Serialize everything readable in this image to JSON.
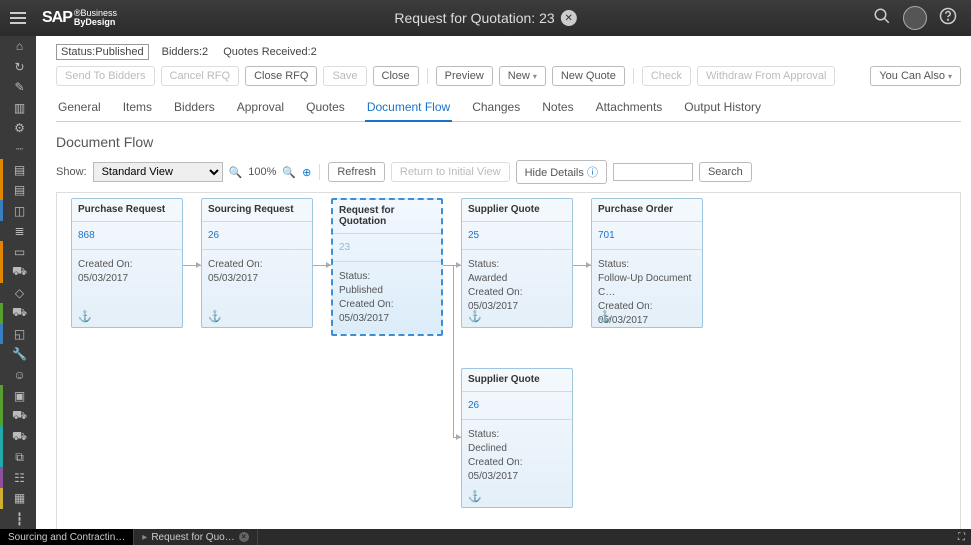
{
  "header": {
    "title": "Request for Quotation: 23"
  },
  "status_line": {
    "status_label": "Status:",
    "status_value": "Published",
    "bidders_label": "Bidders:",
    "bidders_value": "2",
    "quotes_label": "Quotes Received:",
    "quotes_value": "2"
  },
  "toolbar": {
    "send_to_bidders": "Send To Bidders",
    "cancel_rfq": "Cancel RFQ",
    "close_rfq": "Close RFQ",
    "save": "Save",
    "close": "Close",
    "preview": "Preview",
    "new": "New",
    "new_quote": "New Quote",
    "check": "Check",
    "withdraw": "Withdraw From Approval",
    "you_can_also": "You Can Also"
  },
  "tabs": [
    "General",
    "Items",
    "Bidders",
    "Approval",
    "Quotes",
    "Document Flow",
    "Changes",
    "Notes",
    "Attachments",
    "Output History"
  ],
  "active_tab": "Document Flow",
  "section_title": "Document Flow",
  "flow_tb": {
    "show_label": "Show:",
    "view": "Standard View",
    "zoom": "100%",
    "refresh": "Refresh",
    "return_initial": "Return to Initial View",
    "hide_details": "Hide Details",
    "search": "Search"
  },
  "nodes": {
    "pr": {
      "title": "Purchase Request",
      "link": "868",
      "created_label": "Created On:",
      "created": "05/03/2017"
    },
    "sr": {
      "title": "Sourcing Request",
      "link": "26",
      "created_label": "Created On:",
      "created": "05/03/2017"
    },
    "rfq": {
      "title": "Request for Quotation",
      "link": "23",
      "status_label": "Status:",
      "status": "Published",
      "created_label": "Created On:",
      "created": "05/03/2017"
    },
    "sq1": {
      "title": "Supplier Quote",
      "link": "25",
      "status_label": "Status:",
      "status": "Awarded",
      "created_label": "Created On:",
      "created": "05/03/2017"
    },
    "sq2": {
      "title": "Supplier Quote",
      "link": "26",
      "status_label": "Status:",
      "status": "Declined",
      "created_label": "Created On:",
      "created": "05/03/2017"
    },
    "po": {
      "title": "Purchase Order",
      "link": "701",
      "status_label": "Status:",
      "status": "Follow-Up Document C…",
      "created_label": "Created On:",
      "created": "05/03/2017"
    }
  },
  "footer": {
    "task1": "Sourcing and Contractin…",
    "task2": "Request for Quo…"
  }
}
